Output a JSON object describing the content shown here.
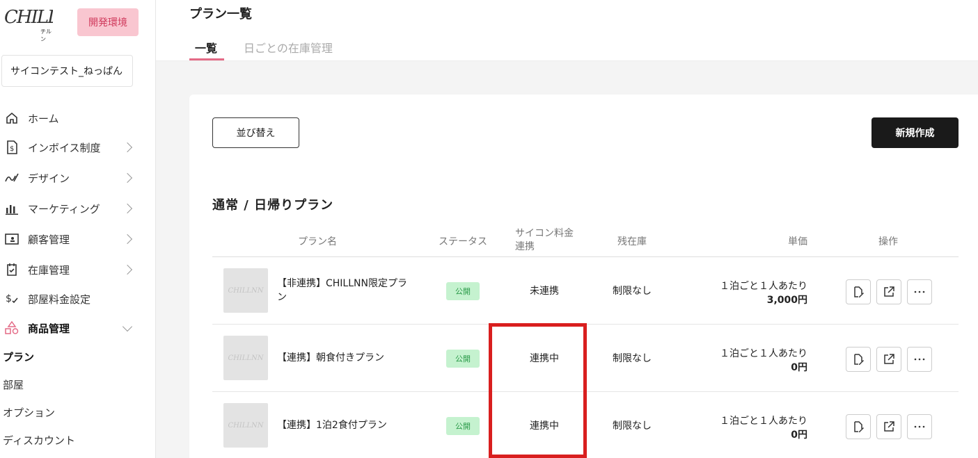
{
  "sidebar": {
    "logo_text": "CHILLNN",
    "logo_sub": "チルン",
    "env_badge": "開発環境",
    "store_name": "サイコンテスト_ねっぱん",
    "nav": [
      {
        "label": "ホーム",
        "icon": "home-icon"
      },
      {
        "label": "インボイス制度",
        "icon": "invoice-icon"
      },
      {
        "label": "デザイン",
        "icon": "design-icon"
      },
      {
        "label": "マーケティング",
        "icon": "chart-icon"
      },
      {
        "label": "顧客管理",
        "icon": "customer-icon"
      },
      {
        "label": "在庫管理",
        "icon": "inventory-icon"
      },
      {
        "label": "部屋料金設定",
        "icon": "room-price-icon"
      },
      {
        "label": "商品管理",
        "icon": "product-icon"
      }
    ],
    "sub_items": [
      "プラン",
      "部屋",
      "オプション",
      "ディスカウント"
    ]
  },
  "header": {
    "title": "プラン一覧",
    "tabs": [
      "一覧",
      "日ごとの在庫管理"
    ]
  },
  "toolbar": {
    "sort_label": "並び替え",
    "new_label": "新規作成"
  },
  "section": {
    "title": "通常 / 日帰りプラン"
  },
  "table": {
    "headers": {
      "name": "プラン名",
      "status": "ステータス",
      "link_line1": "サイコン料金",
      "link_line2": "連携",
      "stock": "残在庫",
      "price": "単価",
      "ops": "操作"
    },
    "rows": [
      {
        "name": "【非連携】CHILLNN限定プラン",
        "status": "公開",
        "link": "未連携",
        "stock": "制限なし",
        "price_unit": "１泊ごと１人あたり",
        "price": "3,000円"
      },
      {
        "name": "【連携】朝食付きプラン",
        "status": "公開",
        "link": "連携中",
        "stock": "制限なし",
        "price_unit": "１泊ごと１人あたり",
        "price": "0円"
      },
      {
        "name": "【連携】1泊2食付プラン",
        "status": "公開",
        "link": "連携中",
        "stock": "制限なし",
        "price_unit": "１泊ごと１人あたり",
        "price": "0円"
      }
    ],
    "thumb_text": "CHILLNN"
  },
  "colors": {
    "accent": "#e46a86",
    "badge_bg": "#c5f2cf",
    "badge_text": "#2a9a48",
    "highlight": "#d91f1f",
    "env_bg": "#f9c6d0"
  }
}
